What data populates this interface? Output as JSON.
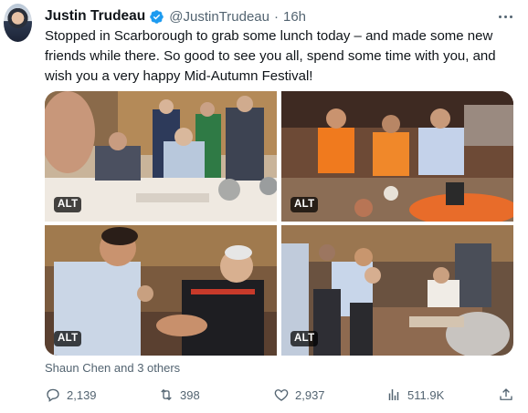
{
  "tweet": {
    "author_name": "Justin Trudeau",
    "handle": "@JustinTrudeau",
    "separator": "·",
    "time": "16h",
    "text": "Stopped in Scarborough to grab some lunch today – and made some new friends while there. So good to see you all, spend some time with you, and wish you a very happy Mid-Autumn Festival!",
    "verified_color": "#1d9bf0"
  },
  "media": {
    "alt_labels": [
      "ALT",
      "ALT",
      "ALT",
      "ALT"
    ]
  },
  "likes_line": "Shaun Chen and 3 others",
  "actions": {
    "replies": "2,139",
    "retweets": "398",
    "likes": "2,937",
    "views": "511.9K"
  },
  "icons": [
    "verified-badge-icon",
    "more-icon",
    "reply-icon",
    "retweet-icon",
    "like-icon",
    "views-icon",
    "share-icon"
  ]
}
